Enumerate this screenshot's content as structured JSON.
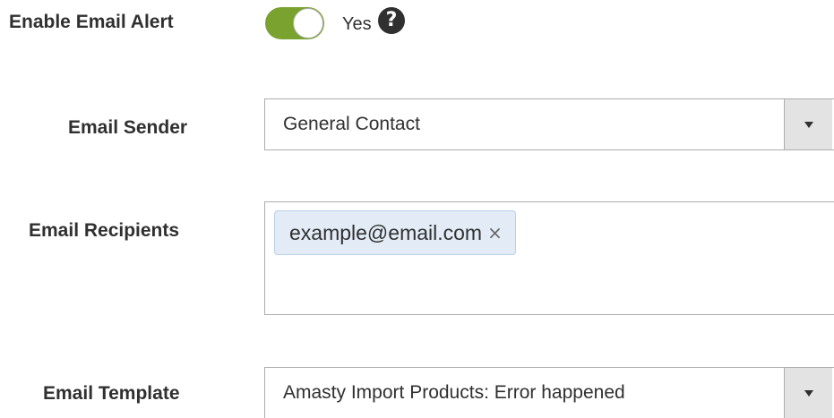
{
  "email_alert": {
    "label": "Enable Email Alert",
    "enabled": true,
    "toggle_text": "Yes",
    "help_icon": "question-circle-icon",
    "toggle_color": "#79a22e"
  },
  "email_sender": {
    "label": "Email Sender",
    "selected": "General Contact",
    "arrow_icon": "chevron-down-icon"
  },
  "email_recipients": {
    "label": "Email Recipients",
    "chips": [
      {
        "text": "example@email.com",
        "remove": "×"
      }
    ]
  },
  "email_template": {
    "label": "Email Template",
    "selected": "Amasty Import Products: Error happened",
    "arrow_icon": "chevron-down-icon"
  }
}
